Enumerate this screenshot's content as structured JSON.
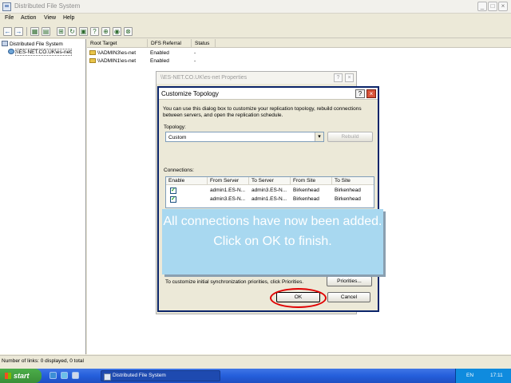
{
  "window": {
    "title": "Distributed File System"
  },
  "menu": [
    "File",
    "Action",
    "View",
    "Help"
  ],
  "tree": {
    "root": "Distributed File System",
    "child": "\\\\ES-NET.CO.UK\\es-net"
  },
  "list": {
    "columns": [
      "Root Target",
      "DFS Referral",
      "Status"
    ],
    "rows": [
      {
        "target": "\\\\ADMIN3\\es-net",
        "referral": "Enabled",
        "status": "-"
      },
      {
        "target": "\\\\ADMIN1\\es-net",
        "referral": "Enabled",
        "status": "-"
      }
    ]
  },
  "props_dialog": {
    "title": "\\\\ES-NET.CO.UK\\es-net Properties"
  },
  "topology_dialog": {
    "title": "Customize Topology",
    "description": "You can use this dialog box to customize your replication topology, rebuild connections between servers, and open the replication schedule.",
    "topology_label": "Topology:",
    "topology_value": "Custom",
    "rebuild_label": "Rebuild",
    "connections_label": "Connections:",
    "columns": [
      "Enable",
      "From Server",
      "To Server",
      "From Site",
      "To Site"
    ],
    "rows": [
      {
        "enable": "✓",
        "from_server": "admin1.ES-N...",
        "to_server": "admin3.ES-N...",
        "from_site": "Birkenhead",
        "to_site": "Birkenhead"
      },
      {
        "enable": "✓",
        "from_server": "admin3.ES-N...",
        "to_server": "admin1.ES-N...",
        "from_site": "Birkenhead",
        "to_site": "Birkenhead"
      }
    ],
    "sync_text": "To customize initial synchronization priorities, click Priorities.",
    "priorities_label": "Priorities...",
    "ok_label": "OK",
    "cancel_label": "Cancel"
  },
  "callout": {
    "text": "All connections have now been added. Click on OK to finish."
  },
  "statusbar": {
    "text": "Number of links: 0 displayed, 0 total"
  },
  "taskbar": {
    "start_label": "start",
    "task_label": "Distributed File System",
    "lang": "EN",
    "clock": "17:11"
  },
  "colors": {
    "title_active": "#0a246a",
    "highlight_ring": "#e00000",
    "callout_bg": "#a8d8f0",
    "taskbar": "#245edb",
    "start": "#3a8f38"
  }
}
